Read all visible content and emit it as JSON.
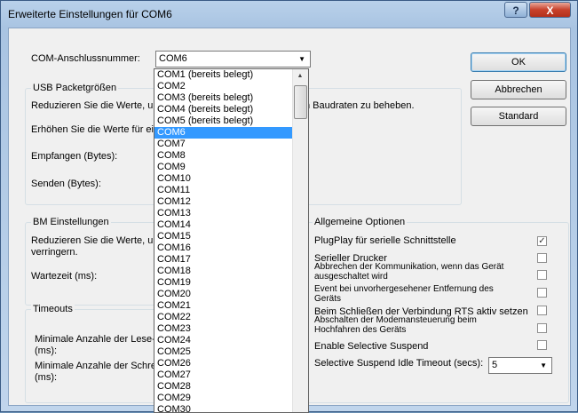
{
  "window": {
    "title": "Erweiterte Einstellungen für COM6"
  },
  "titlebar": {
    "help": "?",
    "close": "X"
  },
  "com_port": {
    "label": "COM-Anschlussnummer:",
    "value": "COM6"
  },
  "buttons": {
    "ok": "OK",
    "cancel": "Abbrechen",
    "default": "Standard"
  },
  "usb": {
    "title": "USB Packetgrößen",
    "desc1": "Reduzieren Sie die Werte, un",
    "desc1_tail": "n Baudraten zu beheben.",
    "desc2": "Erhöhen Sie die Werte für ein",
    "receive": "Empfangen (Bytes):",
    "send": "Senden (Bytes):"
  },
  "bm": {
    "title": "BM Einstellungen",
    "desc1": "Reduzieren Sie die Werte, un",
    "desc2": "verringern.",
    "latency": "Wartezeit (ms):"
  },
  "timeouts": {
    "title": "Timeouts",
    "read1": "Minimale Anzahle der Lese-Ti",
    "read2": "(ms):",
    "write1": "Minimale Anzahle der Schreib",
    "write2": "(ms):"
  },
  "general": {
    "title": "Allgemeine Optionen",
    "options": [
      {
        "label": "PlugPlay für serielle Schnittstelle",
        "checked": true
      },
      {
        "label": "Serieller Drucker",
        "checked": false
      },
      {
        "label": "Abbrechen der Kommunikation, wenn das Gerät ausgeschaltet wird",
        "checked": false
      },
      {
        "label": "Event bei unvorhergesehener Entfernung des Geräts",
        "checked": false
      },
      {
        "label": "Beim Schließen der Verbindung RTS aktiv setzen",
        "checked": false
      },
      {
        "label": "Abschalten der Modemansteuerung beim Hochfahren des Geräts",
        "checked": false
      },
      {
        "label": "Enable Selective Suspend",
        "checked": false
      }
    ],
    "idle_label": "Selective Suspend Idle Timeout (secs):",
    "idle_value": "5"
  },
  "dropdown": {
    "selected": "COM6",
    "items": [
      "COM1 (bereits belegt)",
      "COM2",
      "COM3 (bereits belegt)",
      "COM4 (bereits belegt)",
      "COM5 (bereits belegt)",
      "COM6",
      "COM7",
      "COM8",
      "COM9",
      "COM10",
      "COM11",
      "COM12",
      "COM13",
      "COM14",
      "COM15",
      "COM16",
      "COM17",
      "COM18",
      "COM19",
      "COM20",
      "COM21",
      "COM22",
      "COM23",
      "COM24",
      "COM25",
      "COM26",
      "COM27",
      "COM28",
      "COM29",
      "COM30"
    ]
  }
}
